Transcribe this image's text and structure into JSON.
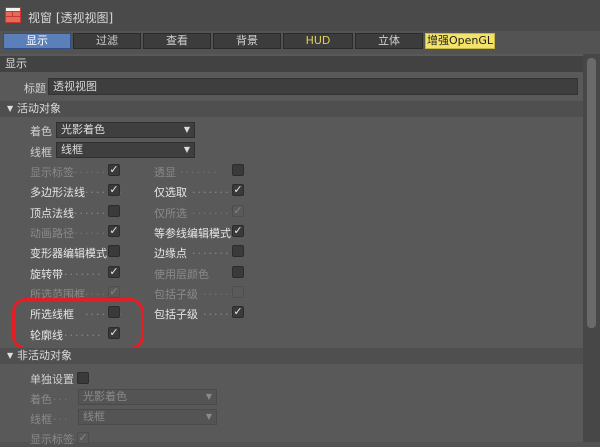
{
  "window": {
    "title": "视窗 [透视视图]"
  },
  "tabs": [
    {
      "label": "显示",
      "active": true
    },
    {
      "label": "过滤"
    },
    {
      "label": "查看"
    },
    {
      "label": "背景"
    },
    {
      "label": "HUD"
    },
    {
      "label": "立体"
    },
    {
      "label": "增强OpenGL"
    }
  ],
  "panel": {
    "header": "显示",
    "title_label": "标题",
    "title_value": "透视视图",
    "active_section": "活动对象",
    "shading_label": "着色",
    "shading_value": "光影着色",
    "wire_label": "线框",
    "wire_value": "线框",
    "left_options": [
      {
        "label": "显示标签",
        "checked": true
      },
      {
        "label": "多边形法线",
        "checked": true
      },
      {
        "label": "顶点法线",
        "checked": false
      },
      {
        "label": "动画路径",
        "checked": true
      },
      {
        "label": "变形器编辑模式",
        "checked": false
      },
      {
        "label": "旋转带",
        "checked": true
      },
      {
        "label": "所选范围框",
        "checked": true
      },
      {
        "label": "所选线框",
        "checked": false
      },
      {
        "label": "轮廓线",
        "checked": true
      }
    ],
    "right_options": [
      {
        "label": "透显",
        "checked": false
      },
      {
        "label": "仅选取",
        "checked": true
      },
      {
        "label": "仅所选",
        "checked": true
      },
      {
        "label": "等参线编辑模式",
        "checked": true
      },
      {
        "label": "边缘点",
        "checked": false
      },
      {
        "label": "使用层颜色",
        "checked": false
      },
      {
        "label": "包括子级",
        "checked": false
      },
      {
        "label": "包括子级",
        "checked": true
      }
    ],
    "inactive_section": "非活动对象",
    "separate_label": "单独设置",
    "separate_checked": false,
    "in_shading_label": "着色",
    "in_shading_value": "光影着色",
    "in_wire_label": "线框",
    "in_wire_value": "线框",
    "in_tags_label": "显示标签",
    "dots": ".......",
    "check": "✓"
  }
}
